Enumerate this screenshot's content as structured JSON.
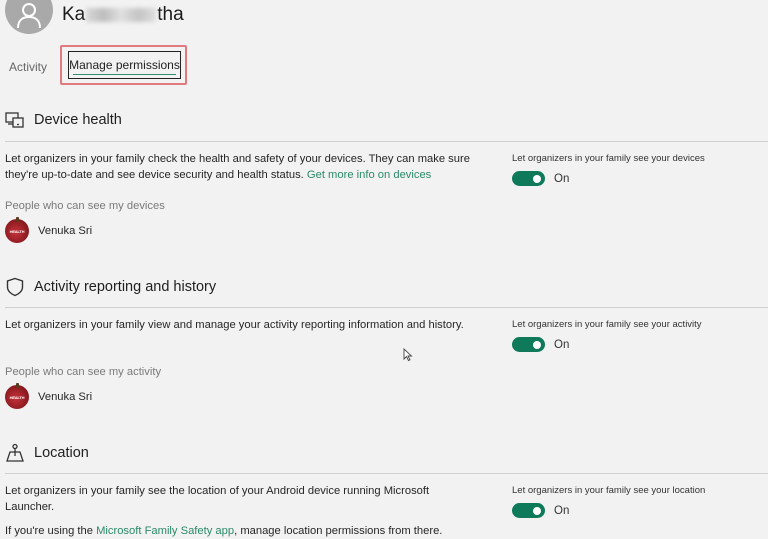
{
  "profile": {
    "name_start": "Ka",
    "name_end": "tha",
    "avatar_icon": "person-icon"
  },
  "tabs": [
    {
      "label": "Activity",
      "active": false
    },
    {
      "label": "Manage permissions",
      "active": true
    }
  ],
  "colors": {
    "accent": "#0f7a5a",
    "link": "#2b8a6a",
    "highlight": "#e07a7f",
    "background": "#f2f2f2"
  },
  "sections": [
    {
      "title": "Device health",
      "icon": "devices-icon",
      "description": "Let organizers in your family check the health and safety of your devices. They can make sure they're up-to-date and see device security and health status.",
      "link": "Get more info on devices",
      "people_label": "People who can see my devices",
      "people": [
        {
          "name": "Venuka Sri"
        }
      ],
      "toggle_label": "Let organizers in your family see your devices",
      "toggle_state": "On"
    },
    {
      "title": "Activity reporting and history",
      "icon": "shield-icon",
      "description": "Let organizers in your family view and manage your activity reporting information and history.",
      "people_label": "People who can see my activity",
      "people": [
        {
          "name": "Venuka Sri"
        }
      ],
      "toggle_label": "Let organizers in your family see your activity",
      "toggle_state": "On"
    },
    {
      "title": "Location",
      "icon": "location-icon",
      "description": "Let organizers in your family see the location of your Android device running Microsoft Launcher.",
      "note_prefix": "If you're using the",
      "note_link": "Microsoft Family Safety app",
      "note_suffix": ", manage location permissions from there.",
      "toggle_label": "Let organizers in your family see your location",
      "toggle_state": "On"
    }
  ]
}
